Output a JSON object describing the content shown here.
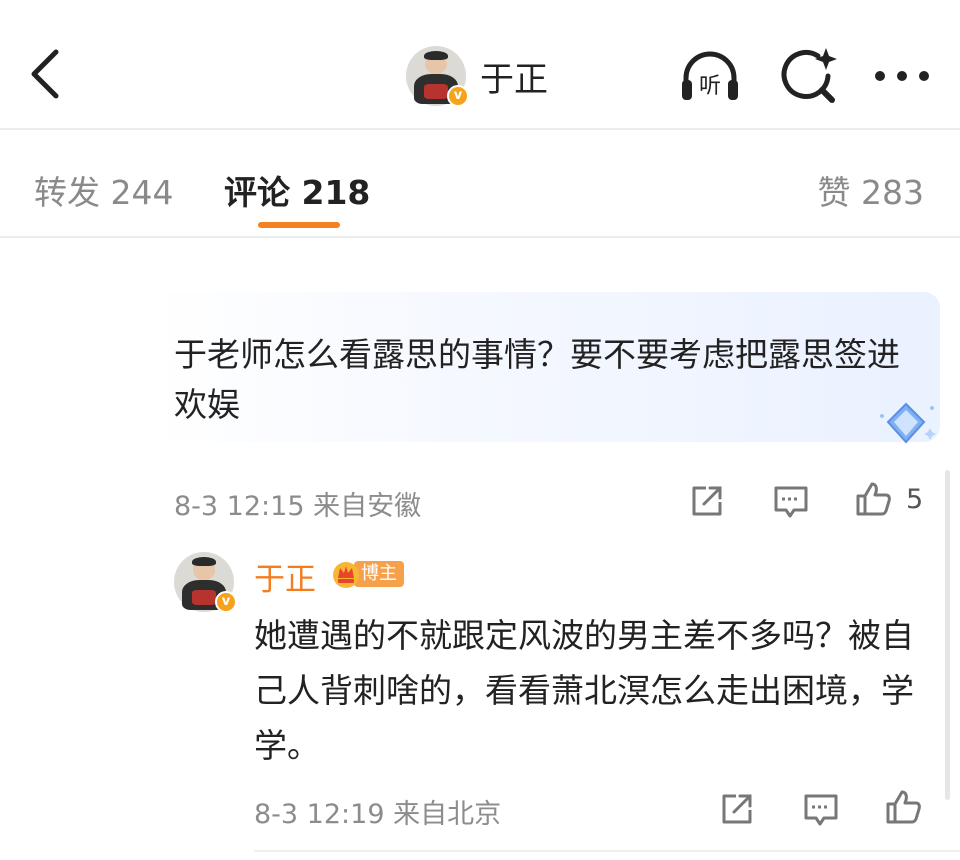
{
  "header": {
    "title": "于正",
    "avatar_verified_glyph": "v",
    "listen_label": "听",
    "icons": [
      "back-arrow-icon",
      "listen-headphones-icon",
      "ai-search-icon",
      "more-icon"
    ]
  },
  "tabs": [
    {
      "label": "转发 244"
    },
    {
      "label": "评论 218",
      "active": true
    },
    {
      "label": "赞 283"
    }
  ],
  "comment": {
    "text": "于老师怎么看露思的事情？要不要考虑把露思签进欢娱",
    "time_location": "8-3 12:15 来自安徽",
    "like_count": "5"
  },
  "reply": {
    "author": "于正",
    "badge": "博主",
    "text": "她遭遇的不就跟定风波的男主差不多吗？被自己人背刺啥的，看看萧北溟怎么走出困境，学学。",
    "time_location": "8-3 12:19 来自北京"
  },
  "colors": {
    "accent_orange": "#f58220",
    "author_name": "#f47d20",
    "meta_gray": "#8c8c8c",
    "bubble_blue": "#eaf1ff"
  }
}
